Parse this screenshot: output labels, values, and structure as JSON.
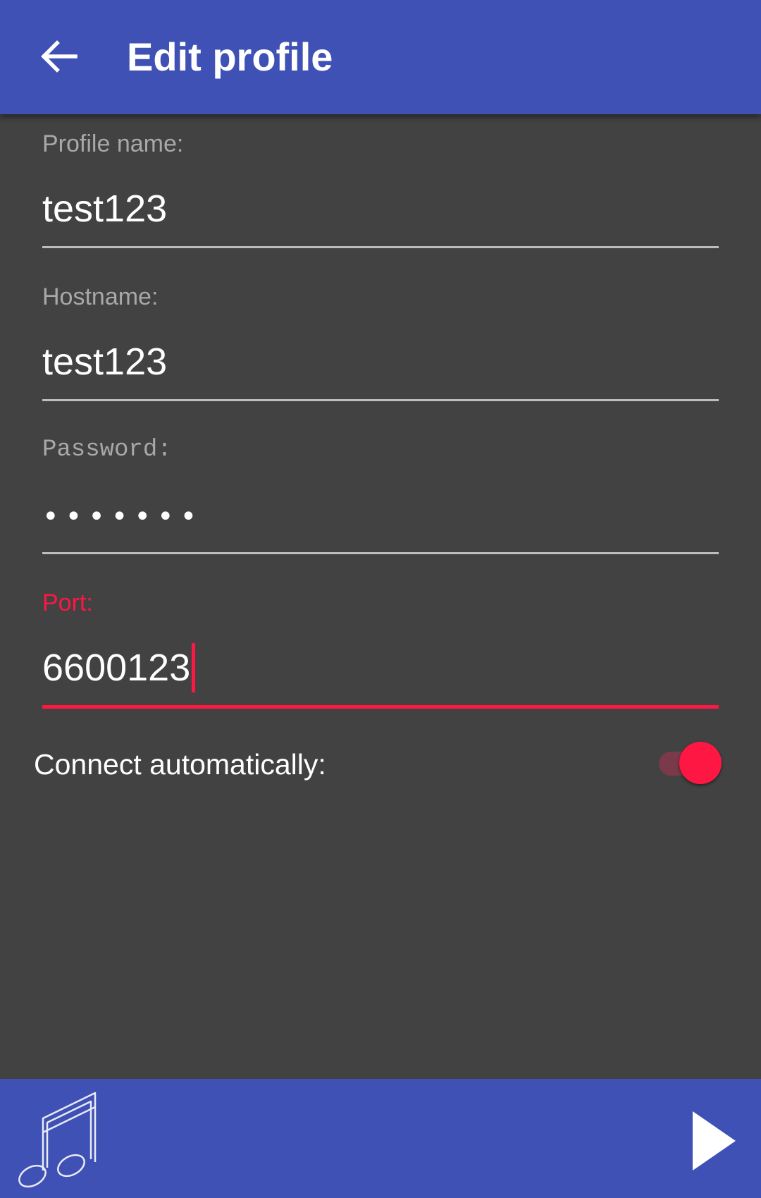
{
  "app_bar": {
    "title": "Edit profile",
    "back_icon": "arrow-back-icon",
    "background": "#3f51b5"
  },
  "form": {
    "profile_name": {
      "label": "Profile name:",
      "value": "test123"
    },
    "hostname": {
      "label": "Hostname:",
      "value": "test123"
    },
    "password": {
      "label": "Password:",
      "masked_value": "•••••••"
    },
    "port": {
      "label": "Port:",
      "value": "6600123",
      "focused": true
    },
    "connect_automatically": {
      "label": "Connect automatically:",
      "enabled": true
    }
  },
  "bottom_bar": {
    "left_icon": "music-note-icon",
    "right_icon": "play-icon",
    "background": "#3f51b5"
  },
  "colors": {
    "primary": "#3f51b5",
    "accent": "#ff1744",
    "background": "#424242"
  }
}
